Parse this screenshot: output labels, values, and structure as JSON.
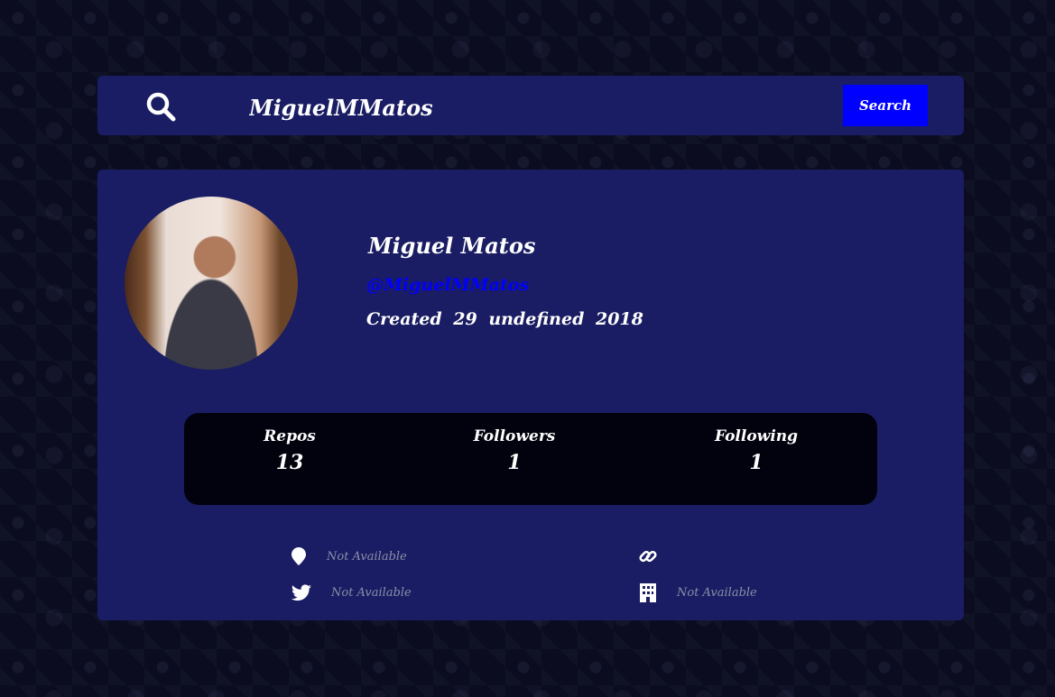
{
  "search": {
    "value": "MiguelMMatos",
    "button_label": "Search"
  },
  "profile": {
    "name": "Miguel Matos",
    "username": "@MiguelMMatos",
    "created": "Created 29 undefined 2018"
  },
  "stats": [
    {
      "label": "Repos",
      "value": "13"
    },
    {
      "label": "Followers",
      "value": "1"
    },
    {
      "label": "Following",
      "value": "1"
    }
  ],
  "info": {
    "location": "Not Available",
    "blog": "",
    "twitter": "Not Available",
    "company": "Not Available"
  },
  "colors": {
    "background": "#0b0c1f",
    "panel": "#1a1d63",
    "accent": "#0000ff",
    "stats_bg": "#02020e",
    "muted_text": "#8a8fa8"
  },
  "icons": [
    "search-icon",
    "location-pin-icon",
    "link-icon",
    "twitter-icon",
    "building-icon"
  ]
}
